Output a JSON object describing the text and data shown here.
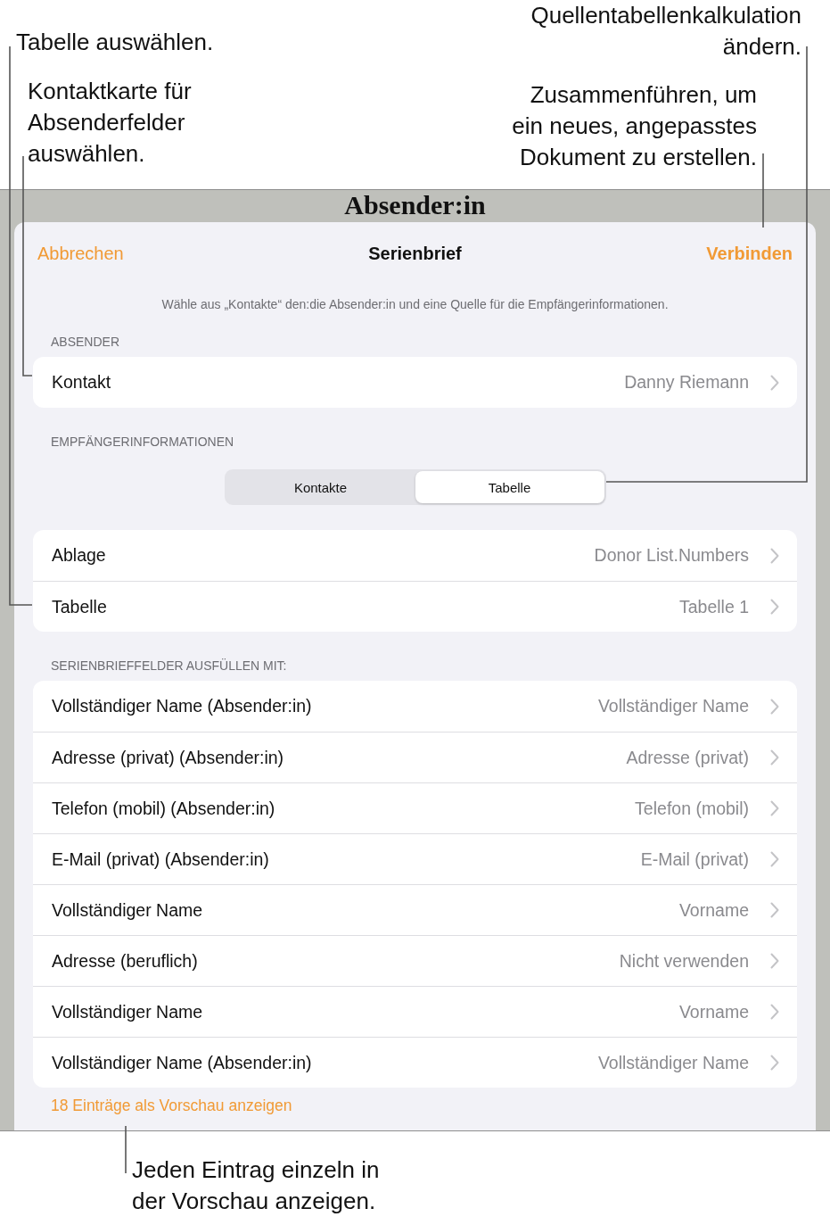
{
  "callouts": {
    "select_table": "Tabelle auswählen.",
    "contact_card": "Kontaktkarte für\nAbsenderfelder\nauswählen.",
    "source_table": "Quellentabellenkalkulation\nändern.",
    "merge": "Zusammenführen, um\nein neues, angepasstes\nDokument zu erstellen.",
    "preview": "Jeden Eintrag einzeln in\nder Vorschau anzeigen."
  },
  "background_title": "Absender:in",
  "nav": {
    "cancel": "Abbrechen",
    "title": "Serienbrief",
    "confirm": "Verbinden"
  },
  "description": "Wähle aus „Kontakte“ den:die Absender:in und eine Quelle für die Empfängerinformationen.",
  "sender": {
    "header": "ABSENDER",
    "rows": [
      {
        "label": "Kontakt",
        "value": "Danny Riemann"
      }
    ]
  },
  "recipient": {
    "header": "EMPFÄNGERINFORMATIONEN",
    "segments": [
      {
        "label": "Kontakte",
        "selected": false
      },
      {
        "label": "Tabelle",
        "selected": true
      }
    ],
    "rows": [
      {
        "label": "Ablage",
        "value": "Donor List.Numbers"
      },
      {
        "label": "Tabelle",
        "value": "Tabelle 1"
      }
    ]
  },
  "fields": {
    "header": "SERIENBRIEFFELDER AUSFÜLLEN MIT:",
    "rows": [
      {
        "label": "Vollständiger Name (Absender:in)",
        "value": "Vollständiger Name"
      },
      {
        "label": "Adresse (privat) (Absender:in)",
        "value": "Adresse (privat)"
      },
      {
        "label": "Telefon (mobil) (Absender:in)",
        "value": "Telefon (mobil)"
      },
      {
        "label": "E-Mail (privat) (Absender:in)",
        "value": "E-Mail (privat)"
      },
      {
        "label": "Vollständiger Name",
        "value": "Vorname"
      },
      {
        "label": "Adresse (beruflich)",
        "value": "Nicht verwenden"
      },
      {
        "label": "Vollständiger Name",
        "value": "Vorname"
      },
      {
        "label": "Vollständiger Name (Absender:in)",
        "value": "Vollständiger Name"
      }
    ]
  },
  "preview_link": "18 Einträge als Vorschau anzeigen"
}
